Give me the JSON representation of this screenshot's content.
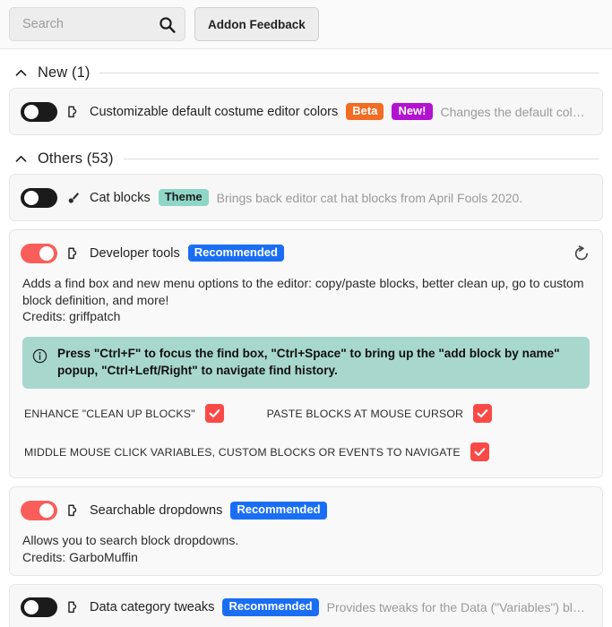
{
  "topbar": {
    "search_placeholder": "Search",
    "search_value": "",
    "search_icon": "search-icon",
    "feedback_label": "Addon Feedback"
  },
  "colors": {
    "toggle_on": "#fa5e5a",
    "toggle_off": "#1b1b1b",
    "badge_beta": "#f26c23",
    "badge_new": "#b312d1",
    "badge_theme": "#8fd6c6",
    "badge_recommended": "#1a6ef5",
    "checkbox": "#fa4a48",
    "notice_bg": "#a8d8cd",
    "card_bg": "#f7f7f7"
  },
  "sections": [
    {
      "id": "new",
      "title": "New (1)",
      "collapse_icon": "chevron-up-icon",
      "addons": [
        {
          "id": "editor-colored-context-menus",
          "name": "Customizable default costume editor colors",
          "enabled": false,
          "type_icon": "puzzle-piece-icon",
          "tags": [
            {
              "label": "Beta",
              "kind": "beta"
            },
            {
              "label": "New!",
              "kind": "new"
            }
          ],
          "short_description": "Changes the default colors a…",
          "expanded": false
        }
      ]
    },
    {
      "id": "others",
      "title": "Others (53)",
      "collapse_icon": "chevron-up-icon",
      "addons": [
        {
          "id": "cat-blocks",
          "name": "Cat blocks",
          "enabled": false,
          "type_icon": "paintbrush-icon",
          "tags": [
            {
              "label": "Theme",
              "kind": "theme"
            }
          ],
          "short_description": "Brings back editor cat hat blocks from April Fools 2020.",
          "expanded": false
        },
        {
          "id": "editor-devtools",
          "name": "Developer tools",
          "enabled": true,
          "type_icon": "puzzle-piece-icon",
          "tags": [
            {
              "label": "Recommended",
              "kind": "recommended"
            }
          ],
          "reset_icon": "reset-arrow-icon",
          "expanded": true,
          "description": "Adds a find box and new menu options to the editor: copy/paste blocks, better clean up, go to custom block definition, and more!",
          "credits": "Credits: griffpatch",
          "notice": {
            "icon": "info-circle-icon",
            "text": "Press \"Ctrl+F\" to focus the find box, \"Ctrl+Space\" to bring up the \"add block by name\" popup, \"Ctrl+Left/Right\" to navigate find history."
          },
          "settings": [
            {
              "label": "ENHANCE \"CLEAN UP BLOCKS\"",
              "checked": true
            },
            {
              "label": "PASTE BLOCKS AT MOUSE CURSOR",
              "checked": true
            },
            {
              "label": "MIDDLE MOUSE CLICK VARIABLES, CUSTOM BLOCKS OR EVENTS TO NAVIGATE",
              "checked": true
            }
          ]
        },
        {
          "id": "searchable-dropdowns",
          "name": "Searchable dropdowns",
          "enabled": true,
          "type_icon": "puzzle-piece-icon",
          "tags": [
            {
              "label": "Recommended",
              "kind": "recommended"
            }
          ],
          "expanded": true,
          "description": "Allows you to search block dropdowns.",
          "credits": "Credits: GarboMuffin"
        },
        {
          "id": "data-category-tweaks",
          "name": "Data category tweaks",
          "enabled": false,
          "type_icon": "puzzle-piece-icon",
          "tags": [
            {
              "label": "Recommended",
              "kind": "recommended"
            }
          ],
          "short_description": "Provides tweaks for the Data (\"Variables\") block …",
          "expanded": false
        }
      ]
    }
  ]
}
